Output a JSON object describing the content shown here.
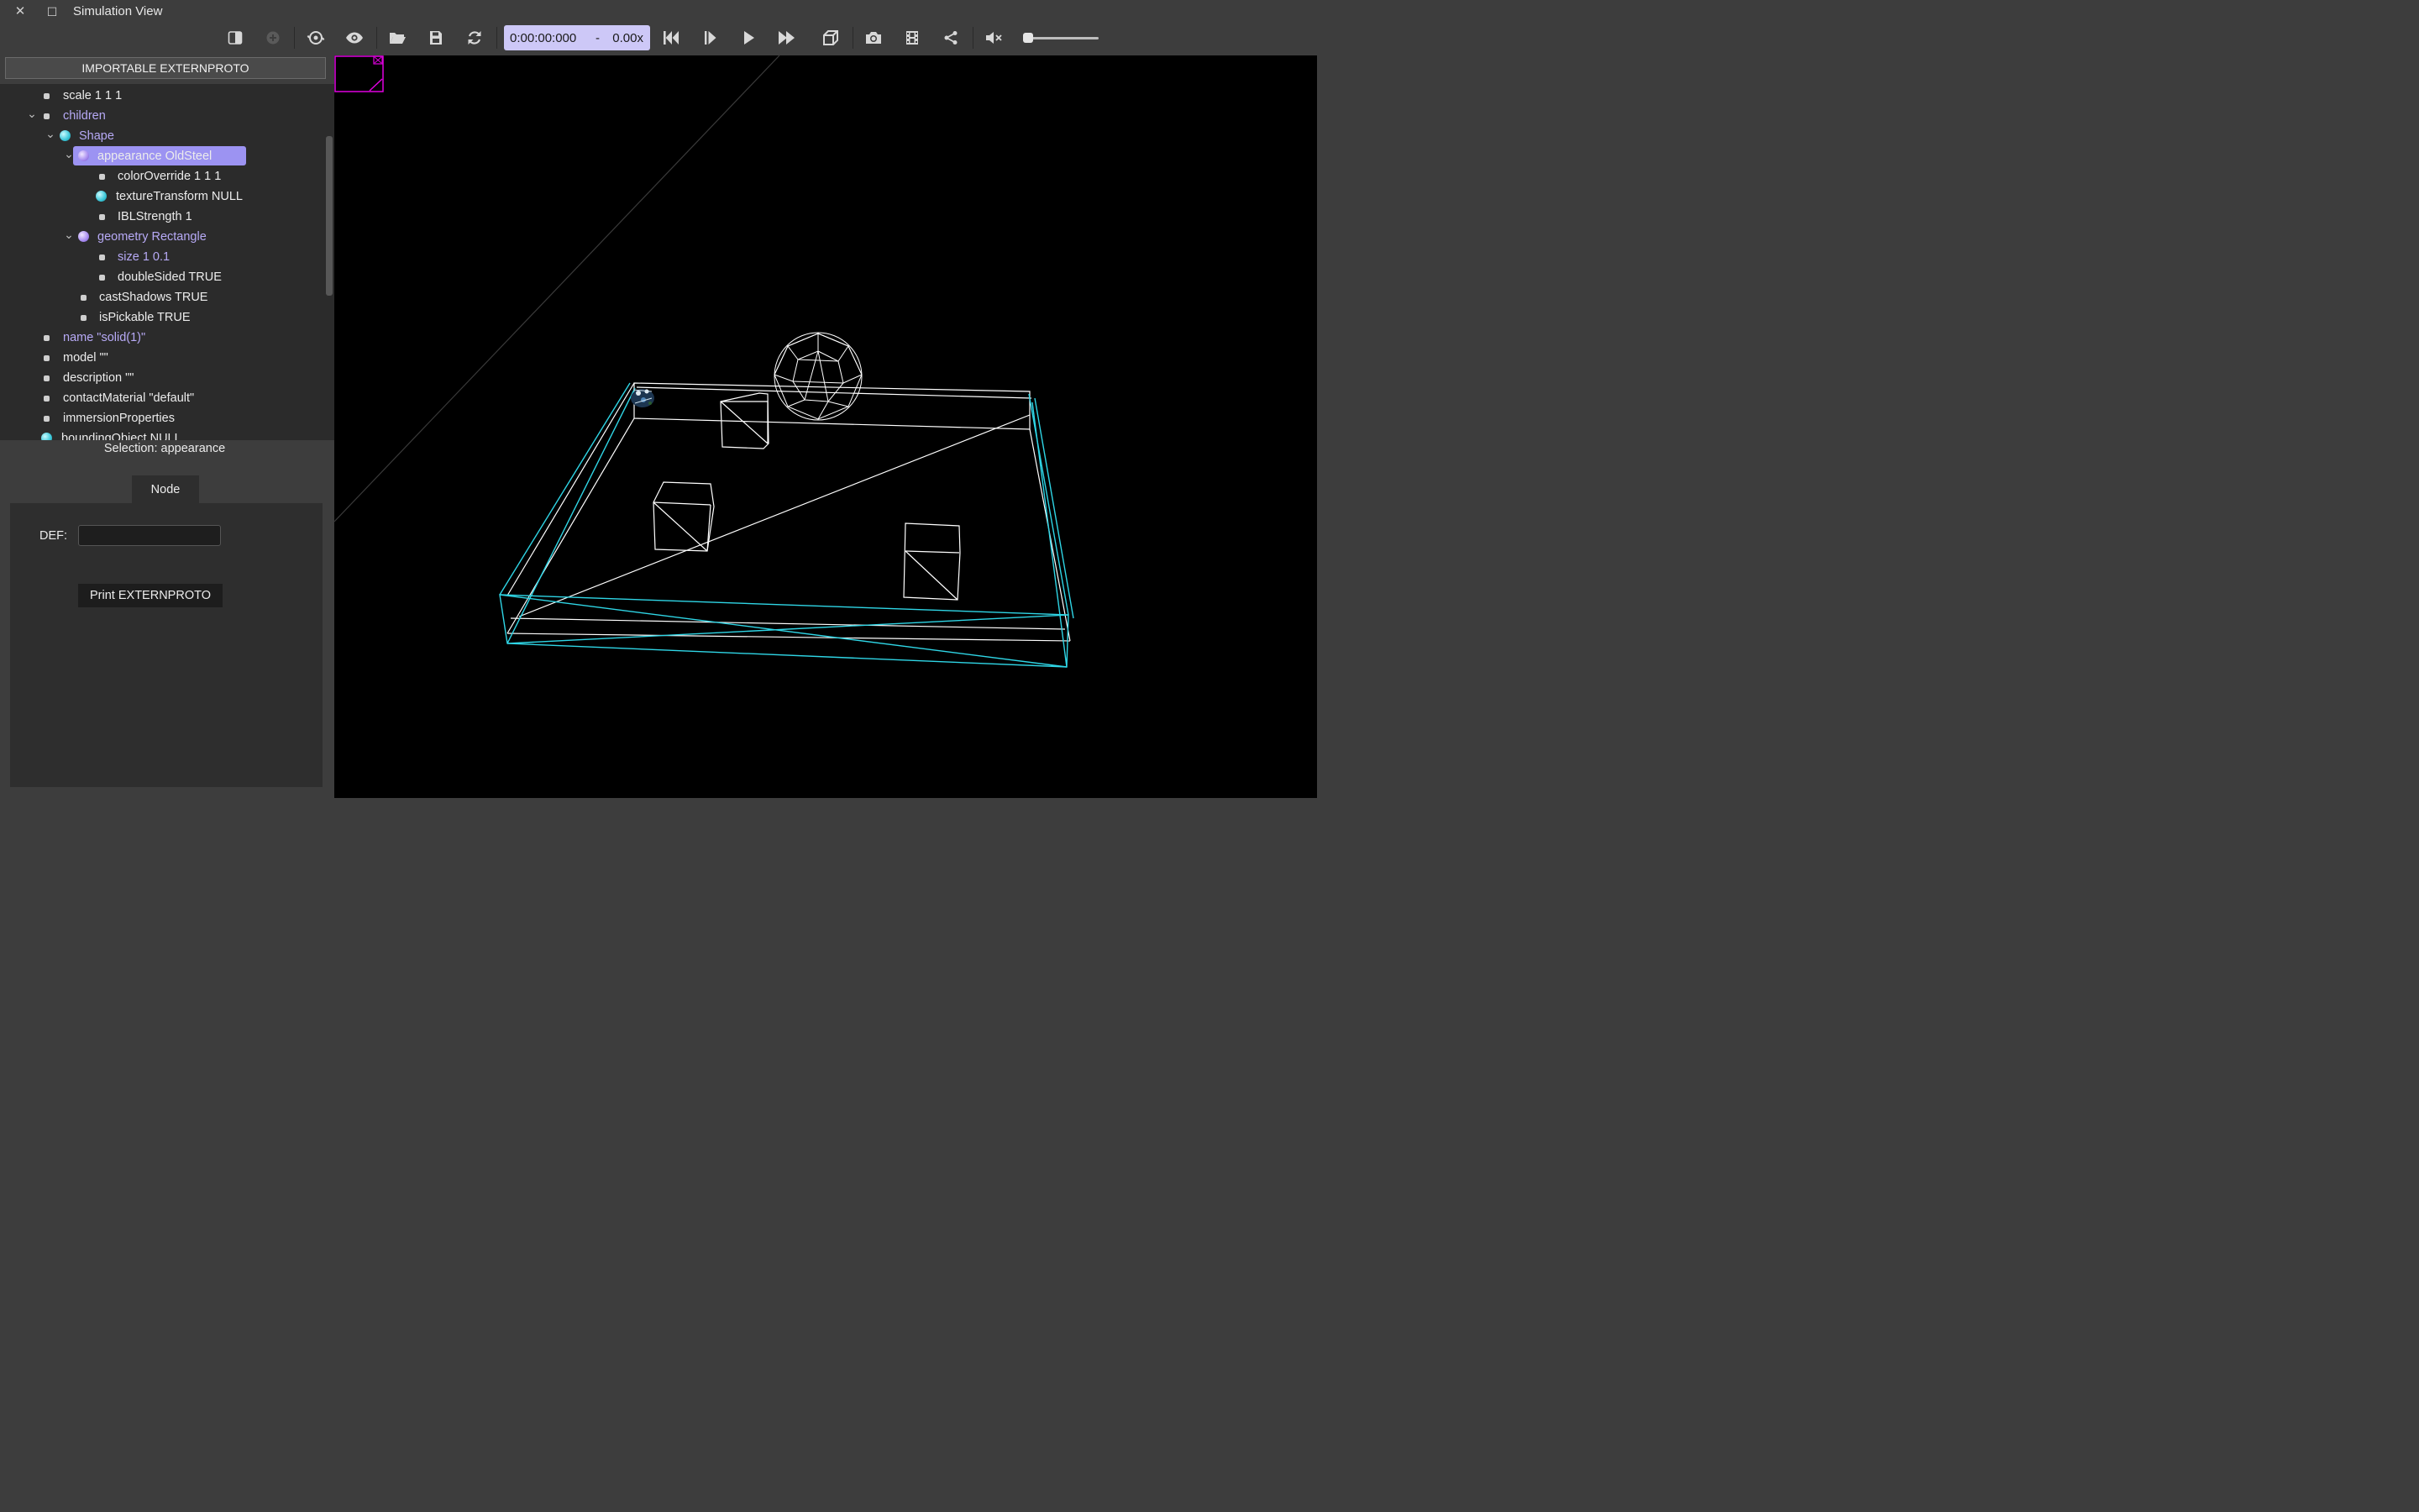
{
  "window": {
    "title": "Simulation View",
    "close_glyph": "✕",
    "maximize_glyph": "☐"
  },
  "toolbar": {
    "icons": [
      "hide-scene-tree-icon",
      "add-node-icon",
      "viewpoint-icon",
      "visibility-icon",
      "open-world-icon",
      "save-world-icon",
      "reload-world-icon",
      "reset-simulation-icon",
      "step-icon",
      "run-icon",
      "fast-icon",
      "view-icon",
      "screenshot-icon",
      "movie-icon",
      "share-icon",
      "mute-icon"
    ],
    "time": "0:00:00:000",
    "time_sep": "-",
    "speed": "0.00x",
    "volume": 0
  },
  "left_panel": {
    "externproto_button": "IMPORTABLE EXTERNPROTO",
    "tree": [
      {
        "label": "scale 1 1 1",
        "color": "white",
        "icon": "square"
      },
      {
        "label": "children",
        "color": "purple",
        "icon": "square",
        "expanded": true
      },
      {
        "label": "Shape",
        "color": "purple",
        "icon": "cyan-ball",
        "expanded": true
      },
      {
        "label": "appearance OldSteel",
        "color": "white",
        "icon": "purple-ball",
        "expanded": true,
        "selected": true
      },
      {
        "label": "colorOverride 1 1 1",
        "color": "white",
        "icon": "square"
      },
      {
        "label": "textureTransform NULL",
        "color": "white",
        "icon": "cyan-ball"
      },
      {
        "label": "IBLStrength 1",
        "color": "white",
        "icon": "square"
      },
      {
        "label": "geometry Rectangle",
        "color": "purple",
        "icon": "purple-ball",
        "expanded": true
      },
      {
        "label": "size 1 0.1",
        "color": "purple",
        "icon": "square"
      },
      {
        "label": "doubleSided TRUE",
        "color": "white",
        "icon": "square"
      },
      {
        "label": "castShadows TRUE",
        "color": "white",
        "icon": "square"
      },
      {
        "label": "isPickable TRUE",
        "color": "white",
        "icon": "square"
      },
      {
        "label": "name \"solid(1)\"",
        "color": "purple",
        "icon": "square"
      },
      {
        "label": "model \"\"",
        "color": "white",
        "icon": "square"
      },
      {
        "label": "description \"\"",
        "color": "white",
        "icon": "square"
      },
      {
        "label": "contactMaterial \"default\"",
        "color": "white",
        "icon": "square"
      },
      {
        "label": "immersionProperties",
        "color": "white",
        "icon": "square"
      },
      {
        "label": "boundingObject NULL",
        "color": "white",
        "icon": "cyan-ball"
      }
    ],
    "selection_label": "Selection: appearance",
    "node_tab": "Node",
    "def_label": "DEF:",
    "def_value": "",
    "print_button": "Print EXTERNPROTO"
  },
  "colors": {
    "accent": "#9c93f2",
    "time_bg": "#cdc8f7",
    "wire_white": "#ffffff",
    "wire_cyan": "#2fd6e6",
    "overlay_magenta": "#e000e0"
  }
}
